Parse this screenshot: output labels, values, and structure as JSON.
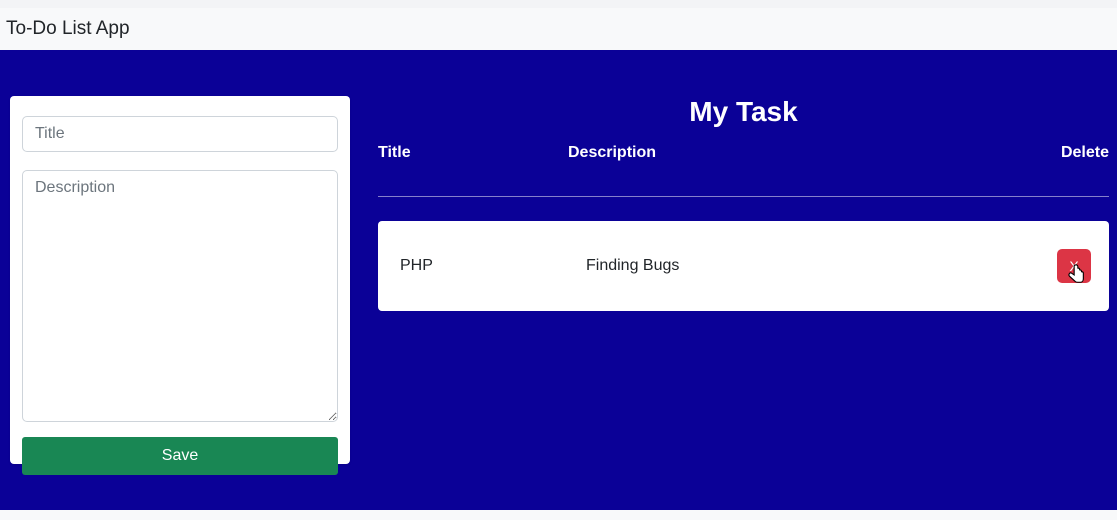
{
  "app": {
    "title": "To-Do List App"
  },
  "form": {
    "title_placeholder": "Title",
    "description_placeholder": "Description",
    "title_value": "",
    "description_value": "",
    "save_label": "Save"
  },
  "tasks_panel": {
    "heading": "My Task",
    "columns": {
      "title": "Title",
      "description": "Description",
      "delete": "Delete"
    },
    "rows": [
      {
        "title": "PHP",
        "description": "Finding Bugs",
        "delete_label": "X"
      }
    ]
  }
}
